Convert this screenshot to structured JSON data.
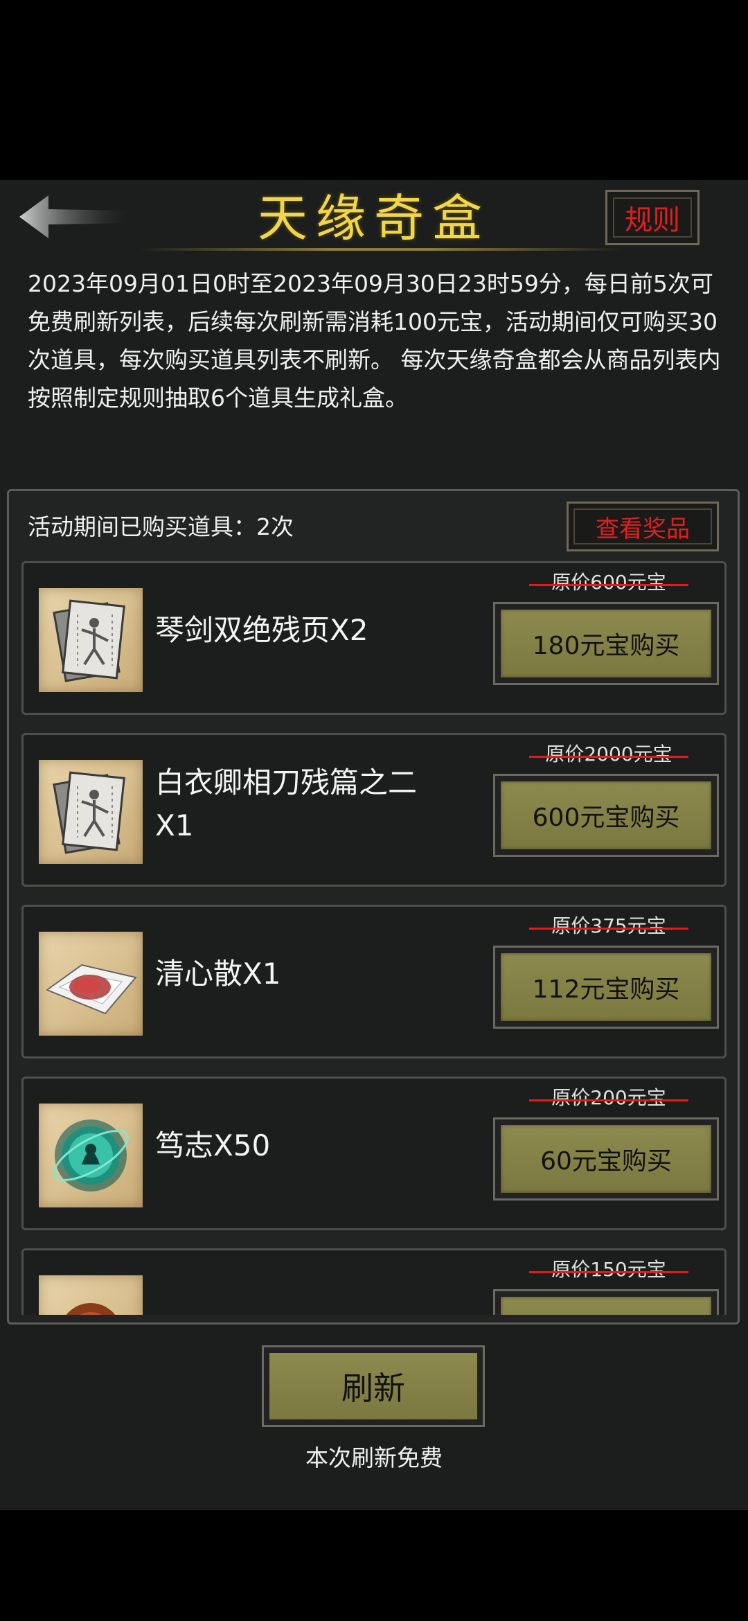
{
  "header": {
    "title": "天缘奇盒",
    "rules_label": "规则"
  },
  "description": "2023年09月01日0时至2023年09月30日23时59分，每日前5次可免费刷新列表，后续每次刷新需消耗100元宝，活动期间仅可购买30次道具，每次购买道具列表不刷新。 每次天缘奇盒都会从商品列表内按照制定规则抽取6个道具生成礼盒。",
  "list": {
    "purchased_text": "活动期间已购买道具：2次",
    "view_prizes_label": "查看奖品",
    "items": [
      {
        "name": "琴剑双绝残页X2",
        "original_price": "原价600元宝",
        "buy_label": "180元宝购买",
        "icon": "martial-manual-icon"
      },
      {
        "name": "白衣卿相刀残篇之二X1",
        "original_price": "原价2000元宝",
        "buy_label": "600元宝购买",
        "icon": "martial-manual-icon"
      },
      {
        "name": "清心散X1",
        "original_price": "原价375元宝",
        "buy_label": "112元宝购买",
        "icon": "red-powder-icon"
      },
      {
        "name": "笃志X50",
        "original_price": "原价200元宝",
        "buy_label": "60元宝购买",
        "icon": "jade-orb-icon"
      },
      {
        "name": "",
        "original_price": "原价150元宝",
        "buy_label": "",
        "icon": "brown-pill-icon"
      }
    ]
  },
  "footer": {
    "refresh_label": "刷新",
    "refresh_note": "本次刷新免费"
  }
}
